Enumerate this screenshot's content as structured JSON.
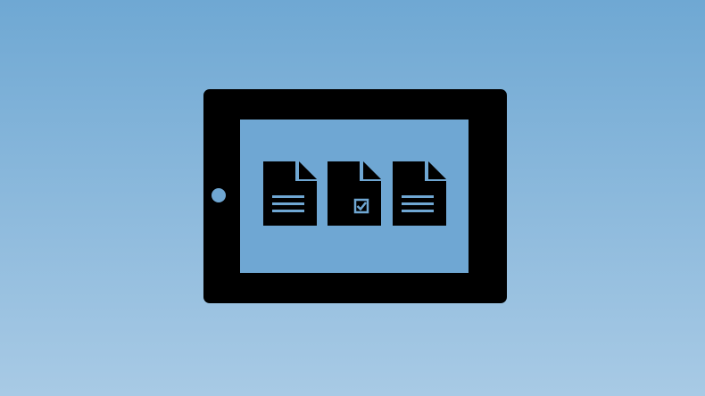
{
  "illustration": {
    "subject": "tablet-with-documents",
    "colors": {
      "background_top": "#6fa8d3",
      "background_bottom": "#a8cae5",
      "device_body": "#000000",
      "screen": "#6fa7d3",
      "home_button": "#6fa7d3"
    },
    "documents": [
      {
        "icon": "document-lines-icon"
      },
      {
        "icon": "document-checkbox-icon",
        "checked": true
      },
      {
        "icon": "document-lines-icon"
      }
    ]
  }
}
